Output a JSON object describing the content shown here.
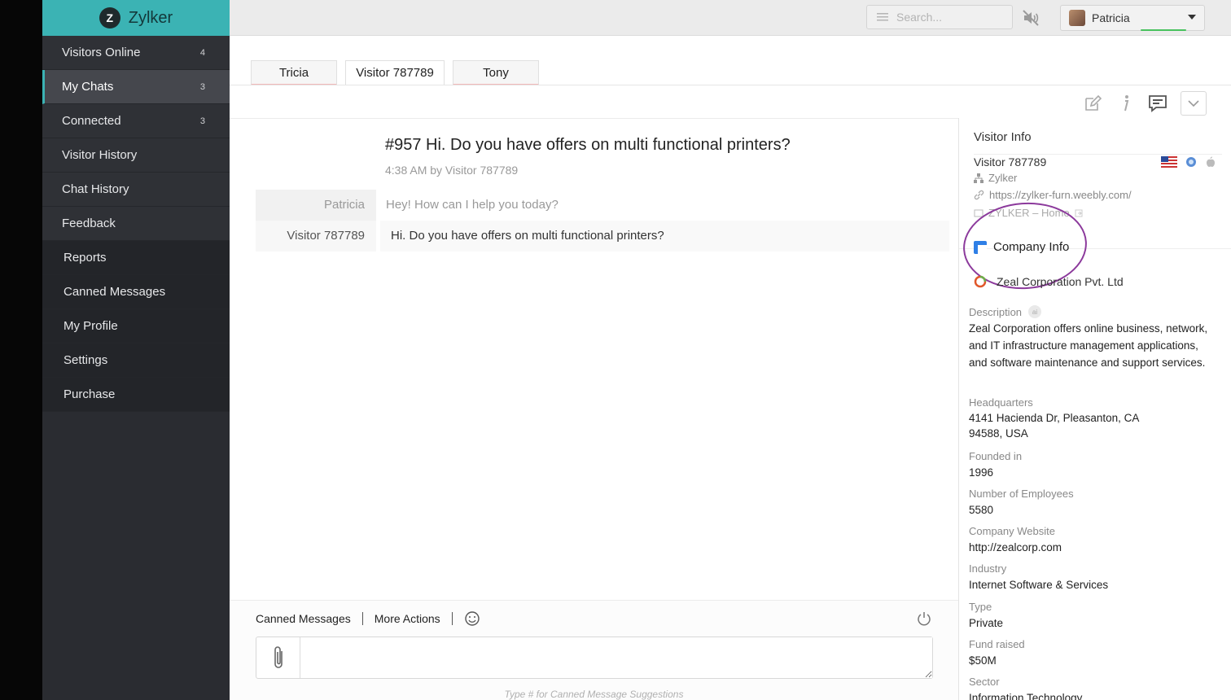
{
  "brand": {
    "initial": "Z",
    "name": "Zylker"
  },
  "sidebar": {
    "items": [
      {
        "label": "Visitors Online",
        "count": "4"
      },
      {
        "label": "My Chats",
        "count": "3"
      },
      {
        "label": "Connected",
        "count": "3"
      },
      {
        "label": "Visitor History",
        "count": ""
      },
      {
        "label": "Chat History",
        "count": ""
      },
      {
        "label": "Feedback",
        "count": ""
      },
      {
        "label": "Reports",
        "count": ""
      },
      {
        "label": "Canned Messages",
        "count": ""
      },
      {
        "label": "My Profile",
        "count": ""
      },
      {
        "label": "Settings",
        "count": ""
      },
      {
        "label": "Purchase",
        "count": ""
      }
    ]
  },
  "topbar": {
    "search_placeholder": "Search...",
    "user_name": "Patricia"
  },
  "tabs": [
    {
      "label": "Tricia"
    },
    {
      "label": "Visitor 787789"
    },
    {
      "label": "Tony"
    }
  ],
  "chat": {
    "title": "#957  Hi. Do you have offers on multi functional printers?",
    "subtitle": "4:38 AM by Visitor 787789",
    "messages": [
      {
        "sender": "Patricia",
        "text": "Hey! How can I help you today?"
      },
      {
        "sender": "Visitor 787789",
        "text": "Hi. Do you have offers on multi functional printers?"
      }
    ]
  },
  "composer": {
    "canned_label": "Canned Messages",
    "more_label": "More Actions",
    "hint": "Type # for Canned Message Suggestions"
  },
  "visitor_info": {
    "heading": "Visitor Info",
    "name": "Visitor 787789",
    "org": "Zylker",
    "url": "https://zylker-furn.weebly.com/",
    "page": "ZYLKER – Home"
  },
  "company_info": {
    "heading": "Company Info",
    "name": "Zeal Corporation Pvt. Ltd",
    "sections": [
      {
        "label": "Description",
        "value": "Zeal Corporation offers online business, network, and IT infrastructure management applications, and software maintenance and support services."
      },
      {
        "label": "Headquarters",
        "value": "4141 Hacienda Dr, Pleasanton, CA 94588, USA"
      },
      {
        "label": "Founded in",
        "value": "1996"
      },
      {
        "label": "Number of Employees",
        "value": "5580"
      },
      {
        "label": "Company Website",
        "value": "http://zealcorp.com"
      },
      {
        "label": "Industry",
        "value": "Internet Software & Services"
      },
      {
        "label": "Type",
        "value": "Private"
      },
      {
        "label": "Fund raised",
        "value": "$50M"
      },
      {
        "label": "Sector",
        "value": "Information Technology"
      }
    ]
  },
  "colors": {
    "accent": "#3bb3b4",
    "sidebar": "#2a2c31",
    "annotation": "#8c3a9c"
  }
}
